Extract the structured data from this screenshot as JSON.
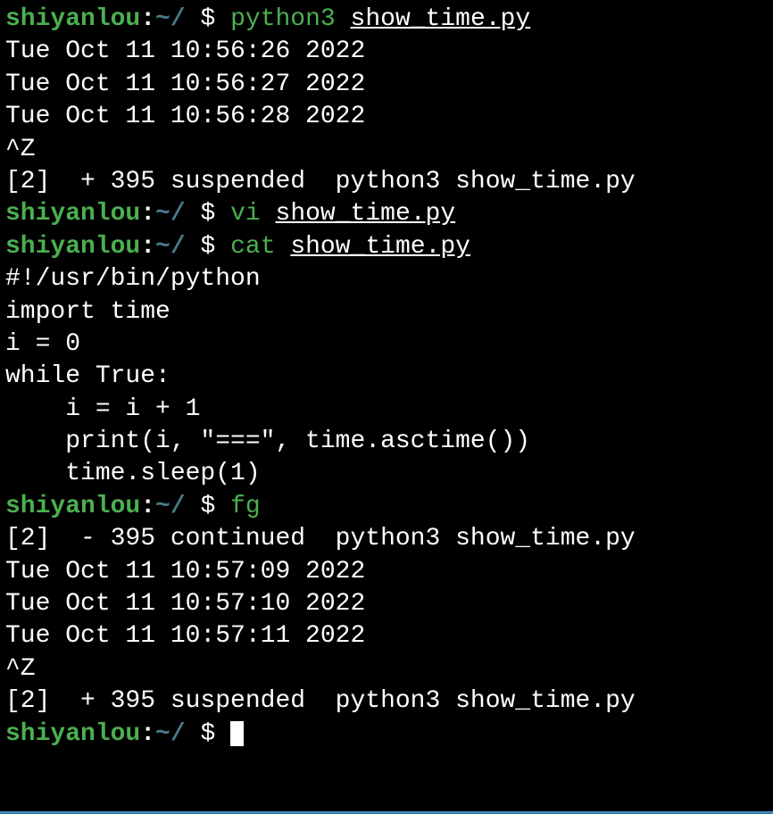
{
  "prompts": [
    {
      "user": "shiyanlou",
      "path": "~/",
      "symbol": "$",
      "cmd": "python3",
      "arg": "show_time.py"
    },
    {
      "user": "shiyanlou",
      "path": "~/",
      "symbol": "$",
      "cmd": "vi",
      "arg": "show_time.py"
    },
    {
      "user": "shiyanlou",
      "path": "~/",
      "symbol": "$",
      "cmd": "cat",
      "arg": "show_time.py"
    },
    {
      "user": "shiyanlou",
      "path": "~/",
      "symbol": "$",
      "cmd": "fg",
      "arg": ""
    },
    {
      "user": "shiyanlou",
      "path": "~/",
      "symbol": "$",
      "cmd": "",
      "arg": ""
    }
  ],
  "run1_output": [
    "Tue Oct 11 10:56:26 2022",
    "Tue Oct 11 10:56:27 2022",
    "Tue Oct 11 10:56:28 2022"
  ],
  "ctrlz": "^Z",
  "job_suspend1": "[2]  + 395 suspended  python3 show_time.py",
  "script_content": [
    "#!/usr/bin/python",
    "import time",
    "i = 0",
    "while True:",
    "    i = i + 1",
    "    print(i, \"===\", time.asctime())",
    "    time.sleep(1)"
  ],
  "job_continue": "[2]  - 395 continued  python3 show_time.py",
  "run2_output": [
    "Tue Oct 11 10:57:09 2022",
    "Tue Oct 11 10:57:10 2022",
    "Tue Oct 11 10:57:11 2022"
  ],
  "job_suspend2": "[2]  + 395 suspended  python3 show_time.py"
}
